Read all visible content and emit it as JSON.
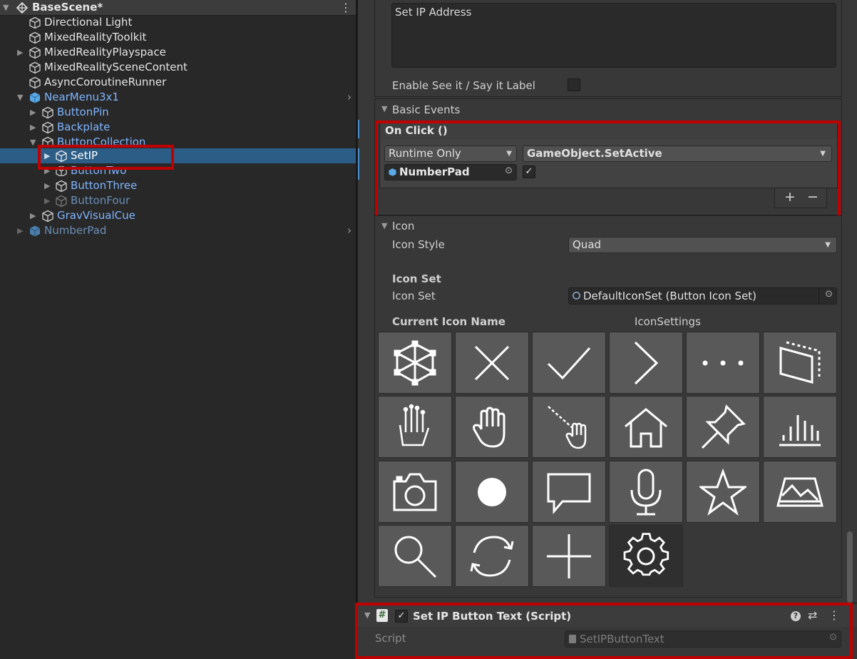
{
  "hierarchy": {
    "scene_name": "BaseScene*",
    "items": [
      {
        "label": "Directional Light"
      },
      {
        "label": "MixedRealityToolkit"
      },
      {
        "label": "MixedRealityPlayspace"
      },
      {
        "label": "MixedRealitySceneContent"
      },
      {
        "label": "AsyncCoroutineRunner"
      },
      {
        "label": "NearMenu3x1"
      },
      {
        "label": "ButtonPin"
      },
      {
        "label": "Backplate"
      },
      {
        "label": "ButtonCollection"
      },
      {
        "label": "SetIP"
      },
      {
        "label": "ButtonTwo"
      },
      {
        "label": "ButtonThree"
      },
      {
        "label": "ButtonFour"
      },
      {
        "label": "GravVisualCue"
      },
      {
        "label": "NumberPad"
      }
    ]
  },
  "inspector": {
    "main_label_text": "Set IP Address",
    "see_it_say_it_label": "Enable See it / Say it Label",
    "basic_events": {
      "header": "Basic Events",
      "on_click_label": "On Click ()",
      "runtime_mode": "Runtime Only",
      "function": "GameObject.SetActive",
      "target_object": "NumberPad",
      "add_symbol": "+",
      "remove_symbol": "−"
    },
    "icon": {
      "header": "Icon",
      "icon_style_label": "Icon Style",
      "icon_style_value": "Quad",
      "icon_set_section": "Icon Set",
      "icon_set_label": "Icon Set",
      "icon_set_value": "DefaultIconSet (Button Icon Set)",
      "current_icon_name_label": "Current Icon Name",
      "icon_settings_label": "IconSettings",
      "icons": [
        "cube-icon",
        "close-icon",
        "check-icon",
        "chevron-right-icon",
        "more-icon",
        "panel-icon",
        "hand-ray-icon",
        "hand-icon",
        "hand-pointer-icon",
        "home-icon",
        "pin-icon",
        "bar-chart-icon",
        "camera-icon",
        "dot-icon",
        "speech-bubble-icon",
        "microphone-icon",
        "star-icon",
        "map-icon",
        "search-icon",
        "refresh-icon",
        "plus-icon",
        "gear-icon"
      ],
      "selected_icon": "gear-icon"
    },
    "component": {
      "title": "Set IP Button Text (Script)",
      "script_label": "Script",
      "script_value": "SetIPButtonText"
    }
  },
  "colors": {
    "accent_highlight": "#c00000",
    "selection": "#2c5d87",
    "link_blue": "#7fb5ff"
  }
}
